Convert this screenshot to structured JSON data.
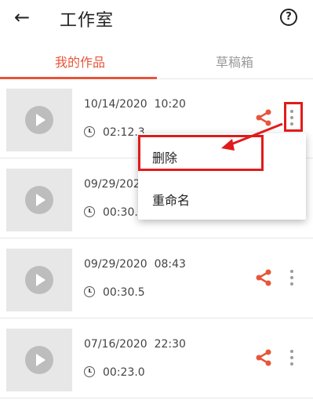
{
  "header": {
    "back_icon": "arrow-left-icon",
    "back_glyph": "←",
    "title": "工作室",
    "help_icon": "question-circle-icon",
    "help_glyph": "?"
  },
  "tabs": [
    {
      "label": "我的作品",
      "active": true
    },
    {
      "label": "草稿箱",
      "active": false
    }
  ],
  "accent_color": "#e8553a",
  "recordings": [
    {
      "datetime": "10/14/2020  10:20",
      "duration": "02:12.3"
    },
    {
      "datetime": "09/29/2020  08:43",
      "duration": "00:30.5"
    },
    {
      "datetime": "09/29/2020  08:43",
      "duration": "00:30.5"
    },
    {
      "datetime": "07/16/2020  22:30",
      "duration": "00:23.0"
    }
  ],
  "context_menu": {
    "delete_label": "删除",
    "rename_label": "重命名"
  },
  "annotation_color": "#e11b1b"
}
